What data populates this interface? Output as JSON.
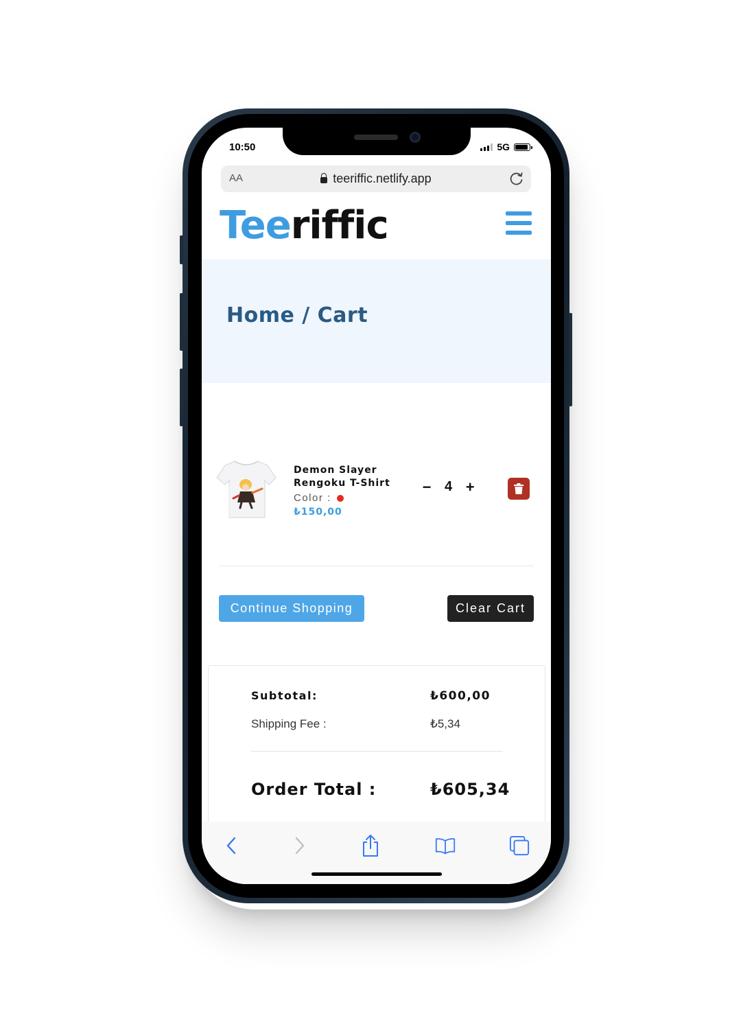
{
  "status": {
    "time": "10:50",
    "network": "5G"
  },
  "browser": {
    "aa_label": "AA",
    "url": "teeriffic.netlify.app"
  },
  "site": {
    "logo_part1": "Tee",
    "logo_part2": "riffic"
  },
  "breadcrumb": "Home / Cart",
  "cart_item": {
    "name_line1": "Demon Slayer",
    "name_line2": "Rengoku T-Shirt",
    "color_label": "Color :",
    "color": "#e52b1f",
    "price": "₺150,00",
    "qty_minus": "−",
    "quantity": "4",
    "qty_plus": "+"
  },
  "buttons": {
    "continue": "Continue Shopping",
    "clear": "Clear Cart"
  },
  "totals": {
    "subtotal_label": "Subtotal:",
    "subtotal_value": "₺600,00",
    "shipping_label": "Shipping Fee :",
    "shipping_value": "₺5,34",
    "order_total_label": "Order Total :",
    "order_total_value": "₺605,34"
  },
  "colors": {
    "accent": "#3f9ce0",
    "danger": "#b03025",
    "dark_button": "#222222"
  },
  "icons": [
    "menu-icon",
    "lock-icon",
    "reload-icon",
    "trash-icon",
    "back-icon",
    "forward-icon",
    "share-icon",
    "bookmarks-icon",
    "tabs-icon"
  ]
}
